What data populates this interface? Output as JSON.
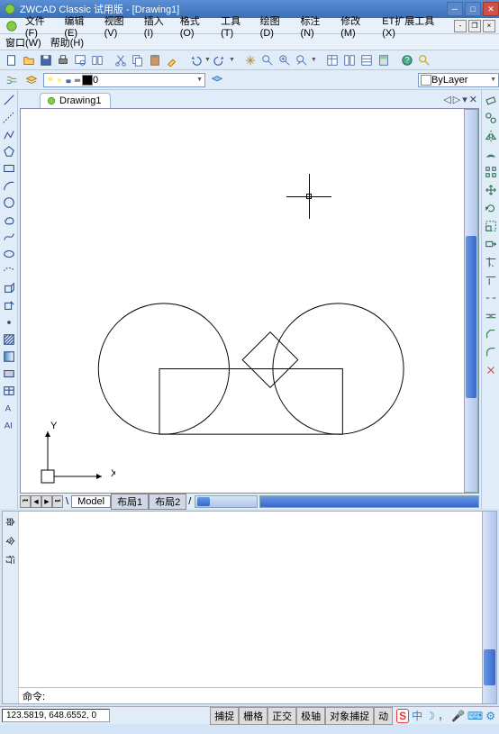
{
  "titlebar": {
    "title": "ZWCAD Classic 试用版 - [Drawing1]"
  },
  "menubar": {
    "file": "文件(F)",
    "edit": "编辑(E)",
    "view": "视图(V)",
    "insert": "插入(I)",
    "format": "格式(O)",
    "tools": "工具(T)",
    "draw": "绘图(D)",
    "dim": "标注(N)",
    "modify": "修改(M)",
    "ext": "ET扩展工具(X)",
    "window": "窗口(W)",
    "help": "帮助(H)"
  },
  "doctab": {
    "name": "Drawing1"
  },
  "layerprop": {
    "value": "0"
  },
  "layerdrop": {
    "value": "ByLayer"
  },
  "layout": {
    "model": "Model",
    "l1": "布局1",
    "l2": "布局2"
  },
  "cmd": {
    "prompt": "命令:"
  },
  "status": {
    "coord": "123.5819, 648.6552, 0",
    "snap": "捕捉",
    "grid": "栅格",
    "ortho": "正交",
    "polar": "极轴",
    "osnap": "对象捕捉",
    "dyn": "动"
  },
  "tray": {
    "ch": "中"
  }
}
